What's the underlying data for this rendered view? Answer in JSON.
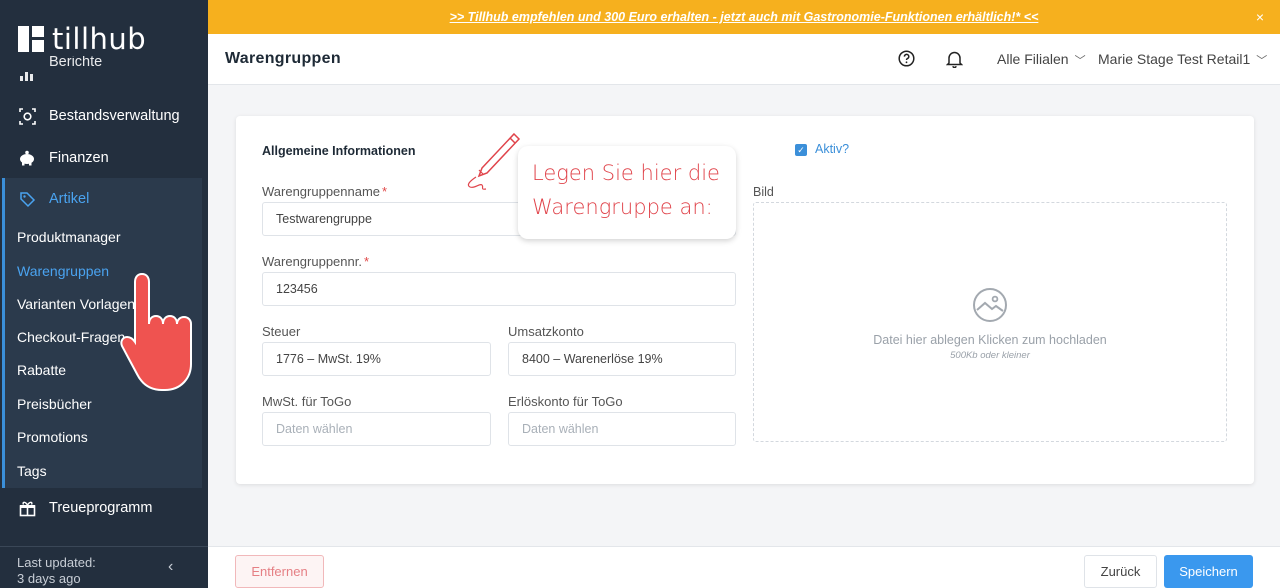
{
  "sidebar": {
    "logo": "tillhub",
    "items": [
      {
        "label": "Berichte",
        "icon": "chart-icon"
      },
      {
        "label": "Bestandsverwaltung",
        "icon": "inventory-icon"
      },
      {
        "label": "Finanzen",
        "icon": "piggy-bank-icon"
      },
      {
        "label": "Artikel",
        "icon": "tag-icon"
      },
      {
        "label": "Treueprogramm",
        "icon": "gift-icon"
      }
    ],
    "subitems": [
      "Produktmanager",
      "Warengruppen",
      "Varianten Vorlagen",
      "Checkout-Fragen",
      "Rabatte",
      "Preisbücher",
      "Promotions",
      "Tags"
    ],
    "active_subitem": "Warengruppen",
    "footer": {
      "line1": "Last updated:",
      "line2": "3 days ago"
    }
  },
  "banner": {
    "text": ">> Tillhub empfehlen und 300 Euro erhalten - jetzt auch mit Gastronomie-Funktionen erhältlich!* <<",
    "close": "×"
  },
  "header": {
    "title": "Warengruppen",
    "branch_select": "Alle Filialen",
    "user_select": "Marie Stage Test Retail1"
  },
  "form": {
    "section_title": "Allgemeine Informationen",
    "active_label": "Aktiv?",
    "active_checked": true,
    "name_label": "Warengruppenname",
    "name_value": "Testwarengruppe",
    "number_label": "Warengruppennr.",
    "number_value": "123456",
    "tax_label": "Steuer",
    "tax_value": "1776 – MwSt. 19%",
    "revenue_label": "Umsatzkonto",
    "revenue_value": "8400 – Warenerlöse 19%",
    "togo_tax_label": "MwSt. für ToGo",
    "togo_tax_placeholder": "Daten wählen",
    "togo_revenue_label": "Erlöskonto für ToGo",
    "togo_revenue_placeholder": "Daten wählen",
    "image_label": "Bild",
    "dropzone_text": "Datei hier ablegen Klicken zum hochladen",
    "dropzone_sub": "500Kb oder kleiner",
    "required_mark": "*"
  },
  "callout": {
    "line1": "Legen Sie hier die",
    "line2": "Warengruppe an:"
  },
  "footer": {
    "remove": "Entfernen",
    "back": "Zurück",
    "save": "Speichern"
  },
  "colors": {
    "sidebar": "#232f3e",
    "accent": "#3b8fd9",
    "banner": "#f6b01e",
    "danger": "#e04848"
  }
}
